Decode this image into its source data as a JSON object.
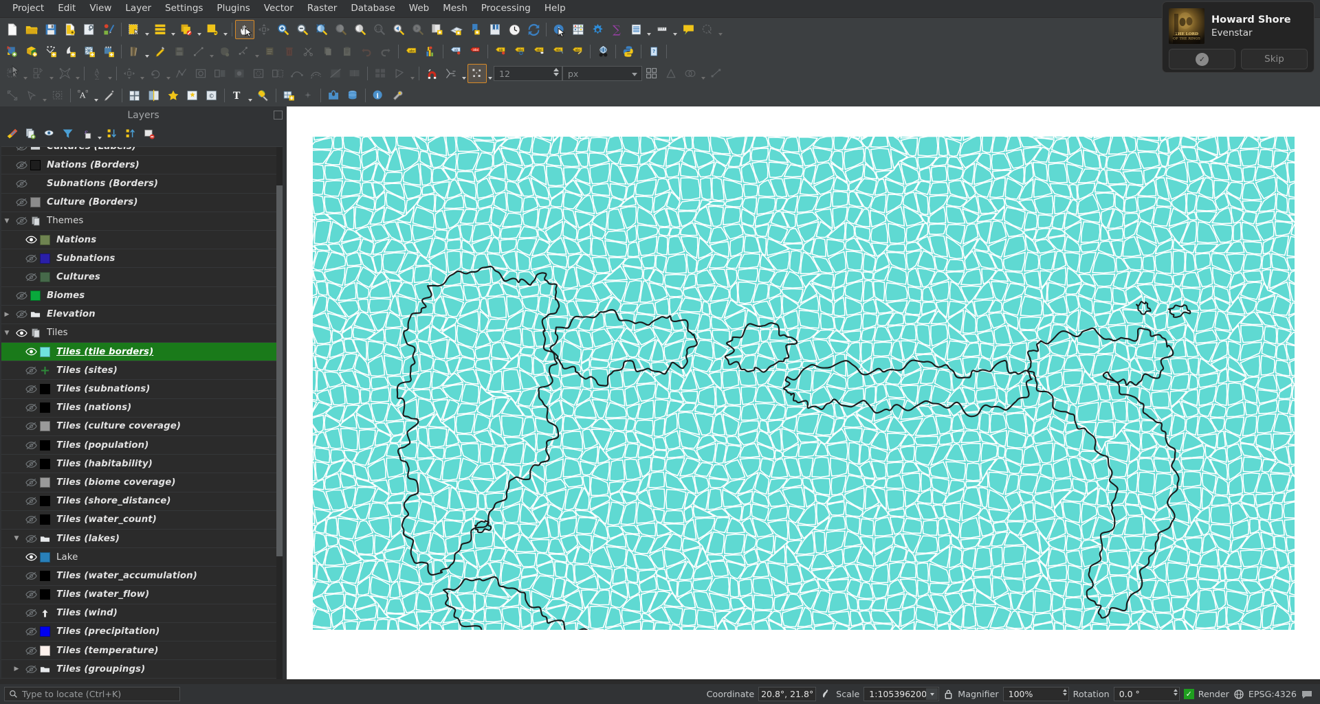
{
  "app": {
    "title": "QGIS"
  },
  "menubar": {
    "items": [
      {
        "label": "Project"
      },
      {
        "label": "Edit"
      },
      {
        "label": "View"
      },
      {
        "label": "Layer"
      },
      {
        "label": "Settings"
      },
      {
        "label": "Plugins"
      },
      {
        "label": "Vector"
      },
      {
        "label": "Raster"
      },
      {
        "label": "Database"
      },
      {
        "label": "Web"
      },
      {
        "label": "Mesh"
      },
      {
        "label": "Processing"
      },
      {
        "label": "Help"
      }
    ]
  },
  "toolbars": {
    "row1": [
      {
        "icon": "new-project-icon",
        "active": false
      },
      {
        "icon": "open-project-icon",
        "active": false
      },
      {
        "icon": "save-project-icon",
        "active": false
      },
      {
        "icon": "save-project-as-icon",
        "active": false
      },
      {
        "icon": "project-properties-icon",
        "active": false
      },
      {
        "icon": "style-manager-icon",
        "active": false
      },
      {
        "icon": "sep"
      },
      {
        "icon": "new-print-layout-icon",
        "active": false
      },
      {
        "icon": "caret"
      },
      {
        "icon": "layout-manager-icon",
        "active": false
      },
      {
        "icon": "caret"
      },
      {
        "icon": "duplicate-layout-icon",
        "active": false
      },
      {
        "icon": "caret"
      },
      {
        "icon": "new-report-icon",
        "active": false
      },
      {
        "icon": "caret"
      },
      {
        "icon": "sep"
      },
      {
        "icon": "pan-map-icon",
        "active": true
      },
      {
        "icon": "pan-to-selection-icon",
        "active": false,
        "dim": true
      },
      {
        "icon": "zoom-in-icon",
        "active": false
      },
      {
        "icon": "zoom-out-icon",
        "active": false
      },
      {
        "icon": "zoom-full-icon",
        "active": false
      },
      {
        "icon": "zoom-to-selection-icon",
        "active": false,
        "dim": true
      },
      {
        "icon": "zoom-to-layer-icon",
        "active": false
      },
      {
        "icon": "zoom-native-icon",
        "active": false,
        "dim": true
      },
      {
        "icon": "zoom-last-icon",
        "active": false
      },
      {
        "icon": "zoom-next-icon",
        "active": false,
        "dim": true
      },
      {
        "icon": "new-map-view-icon",
        "active": false
      },
      {
        "icon": "new-3d-map-view-icon",
        "active": false
      },
      {
        "icon": "new-bookmark-icon",
        "active": false
      },
      {
        "icon": "show-bookmarks-icon",
        "active": false
      },
      {
        "icon": "temporal-controller-icon",
        "active": false
      },
      {
        "icon": "refresh-icon",
        "active": false
      },
      {
        "icon": "sep"
      },
      {
        "icon": "identify-features-icon",
        "active": false
      },
      {
        "icon": "attribute-table-icon",
        "active": false
      },
      {
        "icon": "processing-toolbox-icon",
        "active": false
      },
      {
        "icon": "statistics-icon",
        "active": false
      },
      {
        "icon": "open-table-icon",
        "active": false
      },
      {
        "icon": "caret"
      },
      {
        "icon": "measure-line-icon",
        "active": false
      },
      {
        "icon": "caret"
      },
      {
        "icon": "map-tips-icon",
        "active": false
      },
      {
        "icon": "annotations-icon",
        "active": false,
        "dim": true
      },
      {
        "icon": "caret",
        "dim": true
      }
    ],
    "row2": [
      {
        "icon": "add-vector-layer-icon",
        "active": false
      },
      {
        "icon": "add-raster-layer-icon",
        "active": false
      },
      {
        "icon": "add-delimited-text-layer-icon",
        "active": false
      },
      {
        "icon": "add-wfs-layer-icon",
        "active": false
      },
      {
        "icon": "add-mesh-layer-icon",
        "active": false
      },
      {
        "icon": "add-point-cloud-layer-icon",
        "active": false
      },
      {
        "icon": "sep"
      },
      {
        "icon": "current-edits-icon",
        "active": false
      },
      {
        "icon": "caret"
      },
      {
        "icon": "toggle-editing-icon",
        "active": false
      },
      {
        "icon": "save-layer-edits-icon",
        "active": false,
        "dim": true
      },
      {
        "icon": "add-line-feature-icon",
        "active": false,
        "dim": true
      },
      {
        "icon": "caret",
        "dim": true
      },
      {
        "icon": "add-polygon-feature-icon",
        "active": false,
        "dim": true
      },
      {
        "icon": "vertex-tool-icon",
        "active": false,
        "dim": true
      },
      {
        "icon": "caret",
        "dim": true
      },
      {
        "icon": "modify-attributes-icon",
        "active": false,
        "dim": true
      },
      {
        "icon": "delete-selected-icon",
        "active": false,
        "dim": true
      },
      {
        "icon": "cut-features-icon",
        "active": false,
        "dim": true
      },
      {
        "icon": "copy-features-icon",
        "active": false,
        "dim": true
      },
      {
        "icon": "paste-features-icon",
        "active": false,
        "dim": true
      },
      {
        "icon": "undo-icon",
        "active": false,
        "dim": true
      },
      {
        "icon": "redo-icon",
        "active": false,
        "dim": true
      },
      {
        "icon": "sep"
      },
      {
        "icon": "label-icon",
        "active": false
      },
      {
        "icon": "diagram-icon",
        "active": false
      },
      {
        "icon": "sep"
      },
      {
        "icon": "pin-labels-icon",
        "active": false
      },
      {
        "icon": "highlight-labels-icon",
        "active": false
      },
      {
        "icon": "sep"
      },
      {
        "icon": "move-label-icon",
        "active": false
      },
      {
        "icon": "rotate-label-icon",
        "active": false
      },
      {
        "icon": "change-label-icon",
        "active": false
      },
      {
        "icon": "show-hide-labels-icon",
        "active": false
      },
      {
        "icon": "label-properties-icon",
        "active": false
      },
      {
        "icon": "sep"
      },
      {
        "icon": "metasearch-icon",
        "active": false
      },
      {
        "icon": "sep"
      },
      {
        "icon": "python-console-icon",
        "active": false
      },
      {
        "icon": "sep"
      },
      {
        "icon": "help-icon",
        "active": false
      },
      {
        "icon": "sep"
      }
    ],
    "row3": [
      {
        "icon": "select-features-icon",
        "active": false,
        "dim": true
      },
      {
        "icon": "caret",
        "dim": true
      },
      {
        "icon": "select-by-expression-icon",
        "active": false,
        "dim": true
      },
      {
        "icon": "caret",
        "dim": true
      },
      {
        "icon": "deselect-icon",
        "active": false,
        "dim": true
      },
      {
        "icon": "caret",
        "dim": true
      },
      {
        "icon": "sep"
      },
      {
        "icon": "open-field-calculator-icon",
        "active": false,
        "dim": true
      },
      {
        "icon": "caret",
        "dim": true
      },
      {
        "icon": "sep"
      },
      {
        "icon": "move-feature-icon",
        "active": false,
        "dim": true
      },
      {
        "icon": "caret",
        "dim": true
      },
      {
        "icon": "rotate-feature-icon",
        "active": false,
        "dim": true
      },
      {
        "icon": "caret",
        "dim": true
      },
      {
        "icon": "simplify-feature-icon",
        "active": false,
        "dim": true
      },
      {
        "icon": "add-ring-icon",
        "active": false,
        "dim": true
      },
      {
        "icon": "add-part-icon",
        "active": false,
        "dim": true
      },
      {
        "icon": "fill-ring-icon",
        "active": false,
        "dim": true
      },
      {
        "icon": "delete-ring-icon",
        "active": false,
        "dim": true
      },
      {
        "icon": "delete-part-icon",
        "active": false,
        "dim": true
      },
      {
        "icon": "reshape-features-icon",
        "active": false,
        "dim": true
      },
      {
        "icon": "offset-curve-icon",
        "active": false,
        "dim": true
      },
      {
        "icon": "split-features-icon",
        "active": false,
        "dim": true
      },
      {
        "icon": "merge-features-icon",
        "active": false,
        "dim": true
      },
      {
        "icon": "sep"
      },
      {
        "icon": "grid-table-icon",
        "active": false,
        "dim": true
      },
      {
        "icon": "digitize-shape-icon",
        "active": false,
        "dim": true
      },
      {
        "icon": "caret",
        "dim": true
      },
      {
        "icon": "sep"
      },
      {
        "icon": "snapping-magnet-icon",
        "active": false
      },
      {
        "icon": "snapping-mode-icon",
        "active": false
      },
      {
        "icon": "caret"
      },
      {
        "icon": "snapping-type-icon",
        "active": true
      },
      {
        "icon": "caret"
      }
    ],
    "snapping": {
      "tolerance_value": "12",
      "tolerance_placeholder": "12",
      "units_value": "px"
    },
    "row3b": [
      {
        "icon": "enable-tracing-icon",
        "active": false
      },
      {
        "icon": "topological-editing-icon",
        "active": false,
        "dim": true
      },
      {
        "icon": "avoid-overlap-icon",
        "active": false,
        "dim": true
      },
      {
        "icon": "caret",
        "dim": true
      },
      {
        "icon": "self-snapping-icon",
        "active": false,
        "dim": true
      }
    ],
    "row4": [
      {
        "icon": "pan-selection-icon",
        "active": false,
        "dim": true
      },
      {
        "icon": "select-location-icon",
        "active": false,
        "dim": true
      },
      {
        "icon": "caret",
        "dim": true
      },
      {
        "icon": "zoom-region-icon",
        "active": false,
        "dim": true
      },
      {
        "icon": "sep"
      },
      {
        "icon": "text-annotation-icon",
        "active": false
      },
      {
        "icon": "caret"
      },
      {
        "icon": "edit-annotation-icon",
        "active": false
      },
      {
        "icon": "sep"
      },
      {
        "icon": "georeferencer-icon",
        "active": false
      },
      {
        "icon": "map-swipe-icon",
        "active": false
      },
      {
        "icon": "star-favorites-icon",
        "active": false
      },
      {
        "icon": "decorations-icon",
        "active": false
      },
      {
        "icon": "copyright-label-icon",
        "active": false
      },
      {
        "icon": "sep"
      },
      {
        "icon": "text-tool-icon",
        "active": false
      },
      {
        "icon": "caret"
      },
      {
        "icon": "color-picker-icon",
        "active": false
      },
      {
        "icon": "sep"
      },
      {
        "icon": "new-shapefile-icon",
        "active": false
      },
      {
        "icon": "add-point-icon",
        "active": false,
        "dim": true
      },
      {
        "icon": "sep"
      },
      {
        "icon": "plugin-manager-icon",
        "active": false
      },
      {
        "icon": "database-manager-icon",
        "active": false
      },
      {
        "icon": "sep"
      },
      {
        "icon": "about-info-icon",
        "active": false
      },
      {
        "icon": "settings-wrench-icon",
        "active": false
      }
    ]
  },
  "layers_panel": {
    "title": "Layers",
    "toolbar": [
      {
        "icon": "open-layer-styling-icon"
      },
      {
        "icon": "add-group-icon"
      },
      {
        "icon": "manage-map-themes-icon"
      },
      {
        "icon": "filter-legend-icon"
      },
      {
        "icon": "filter-legend-expression-icon"
      },
      {
        "icon": "caret"
      },
      {
        "icon": "expand-all-icon"
      },
      {
        "icon": "collapse-all-icon"
      },
      {
        "icon": "remove-layer-icon"
      }
    ],
    "items": [
      {
        "name": "Cultures (Labels)",
        "visible": false,
        "indent": 1,
        "swatch": "glyph-labels",
        "expander": "",
        "style": "italic",
        "partial": true
      },
      {
        "name": "Nations (Borders)",
        "visible": false,
        "indent": 1,
        "swatch": "#1d1d1d",
        "swatch_border": "#000000",
        "expander": "",
        "style": "italic"
      },
      {
        "name": "Subnations (Borders)",
        "visible": false,
        "indent": 1,
        "swatch": "none",
        "expander": "",
        "style": "italic"
      },
      {
        "name": "Culture (Borders)",
        "visible": false,
        "indent": 1,
        "swatch": "#8c8c8c",
        "expander": "",
        "style": "italic"
      },
      {
        "name": "Themes",
        "visible": false,
        "indent": 0,
        "swatch": "glyph-group",
        "expander": "down",
        "style": "plain"
      },
      {
        "name": "Nations",
        "visible": true,
        "indent": 2,
        "swatch": "#6f8451",
        "expander": "",
        "style": "italic"
      },
      {
        "name": "Subnations",
        "visible": false,
        "indent": 2,
        "swatch": "#2a1fa8",
        "expander": "",
        "style": "italic"
      },
      {
        "name": "Cultures",
        "visible": false,
        "indent": 2,
        "swatch": "#46694a",
        "expander": "",
        "style": "italic"
      },
      {
        "name": "Biomes",
        "visible": false,
        "indent": 1,
        "swatch": "#09a83c",
        "expander": "",
        "style": "italic"
      },
      {
        "name": "Elevation",
        "visible": false,
        "indent": 1,
        "swatch": "glyph-layergroup",
        "expander": "right",
        "style": "italic"
      },
      {
        "name": "Tiles",
        "visible": true,
        "indent": 0,
        "swatch": "glyph-group",
        "expander": "down",
        "style": "plain"
      },
      {
        "name": "Tiles (tile borders)",
        "visible": true,
        "indent": 2,
        "swatch": "#6fe3dc",
        "selected": true,
        "expander": "",
        "style": "italic"
      },
      {
        "name": "Tiles (sites)",
        "visible": false,
        "indent": 2,
        "swatch": "glyph-plus",
        "expander": "",
        "style": "italic"
      },
      {
        "name": "Tiles (subnations)",
        "visible": false,
        "indent": 2,
        "swatch": "#000000",
        "expander": "",
        "style": "italic"
      },
      {
        "name": "Tiles (nations)",
        "visible": false,
        "indent": 2,
        "swatch": "#000000",
        "expander": "",
        "style": "italic"
      },
      {
        "name": "Tiles (culture coverage)",
        "visible": false,
        "indent": 2,
        "swatch": "#9a9a9a",
        "expander": "",
        "style": "italic"
      },
      {
        "name": "Tiles (population)",
        "visible": false,
        "indent": 2,
        "swatch": "#000000",
        "expander": "",
        "style": "italic"
      },
      {
        "name": "Tiles (habitability)",
        "visible": false,
        "indent": 2,
        "swatch": "#000000",
        "expander": "",
        "style": "italic"
      },
      {
        "name": "Tiles (biome coverage)",
        "visible": false,
        "indent": 2,
        "swatch": "#9a9a9a",
        "expander": "",
        "style": "italic"
      },
      {
        "name": "Tiles (shore_distance)",
        "visible": false,
        "indent": 2,
        "swatch": "#000000",
        "expander": "",
        "style": "italic"
      },
      {
        "name": "Tiles (water_count)",
        "visible": false,
        "indent": 2,
        "swatch": "#000000",
        "expander": "",
        "style": "italic"
      },
      {
        "name": "Tiles (lakes)",
        "visible": false,
        "indent": 2,
        "swatch": "glyph-layergroup",
        "expander": "down",
        "style": "italic"
      },
      {
        "name": "Lake",
        "visible": true,
        "indent": 3,
        "swatch": "#2980b9",
        "expander": "",
        "style": "plain"
      },
      {
        "name": "Tiles (water_accumulation)",
        "visible": false,
        "indent": 2,
        "swatch": "#000000",
        "expander": "",
        "style": "italic"
      },
      {
        "name": "Tiles (water_flow)",
        "visible": false,
        "indent": 2,
        "swatch": "#000000",
        "expander": "",
        "style": "italic"
      },
      {
        "name": "Tiles (wind)",
        "visible": false,
        "indent": 2,
        "swatch": "glyph-arrow-up",
        "expander": "",
        "style": "italic"
      },
      {
        "name": "Tiles (precipitation)",
        "visible": false,
        "indent": 2,
        "swatch": "#0000f0",
        "expander": "",
        "style": "italic"
      },
      {
        "name": "Tiles (temperature)",
        "visible": false,
        "indent": 2,
        "swatch": "#fdf1ec",
        "expander": "",
        "style": "italic"
      },
      {
        "name": "Tiles (groupings)",
        "visible": false,
        "indent": 2,
        "swatch": "glyph-layergroup",
        "expander": "right",
        "style": "italic"
      }
    ]
  },
  "map": {
    "ocean_color": "#5fd9d2",
    "tile_border_color": "#ffffff",
    "coast_color": "#1a1a1a",
    "background_color": "#ffffff"
  },
  "statusbar": {
    "locator_placeholder": "Type to locate (Ctrl+K)",
    "coordinate_label": "Coordinate",
    "coordinate_value": "20.8°, 21.8°",
    "scale_label": "Scale",
    "scale_value": "1:105396200",
    "magnifier_label": "Magnifier",
    "magnifier_value": "100%",
    "rotation_label": "Rotation",
    "rotation_value": "0.0 °",
    "render_label": "Render",
    "render_checked": true,
    "crs_label": "EPSG:4326"
  },
  "toast": {
    "artist": "Howard Shore",
    "track": "Evenstar",
    "accept_label": "",
    "skip_label": "Skip",
    "album_title": "THE LORD OF THE RINGS"
  },
  "colors": {
    "accent_orange": "#d98b28",
    "selection_green": "#1a7a1a",
    "panel_bg": "#313335",
    "toolbar_bg": "#3c3f41",
    "list_bg": "#2b2b2b"
  }
}
